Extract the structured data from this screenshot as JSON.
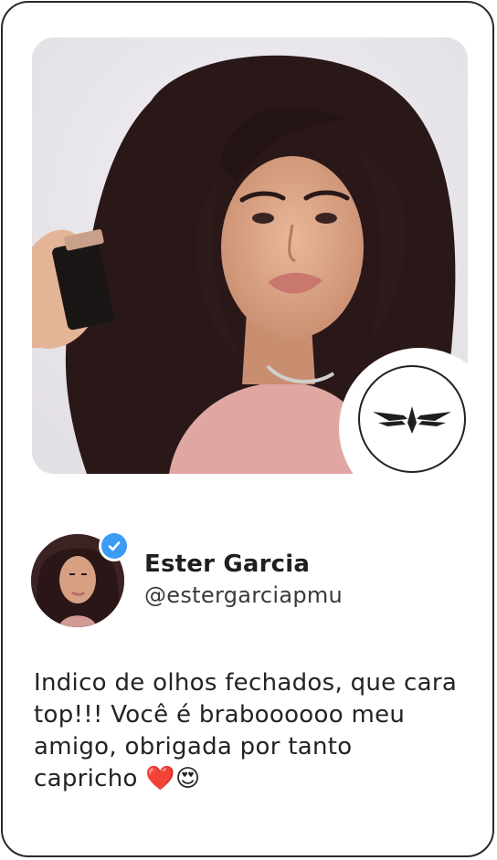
{
  "testimonial": {
    "photo_label": "person-holding-lipstick-photo",
    "logo_icon": "bird-wings-logo-icon",
    "author": {
      "name": "Ester Garcia",
      "handle": "@estergarciapmu",
      "verified_icon": "verified-check-icon"
    },
    "quote": "Indico de olhos fechados, que cara top!!! Você é braboooooo meu amigo, obrigada por tanto capricho ❤️😍"
  },
  "colors": {
    "border": "#2a2a2a",
    "verified": "#3b9cf5",
    "text": "#232323"
  }
}
